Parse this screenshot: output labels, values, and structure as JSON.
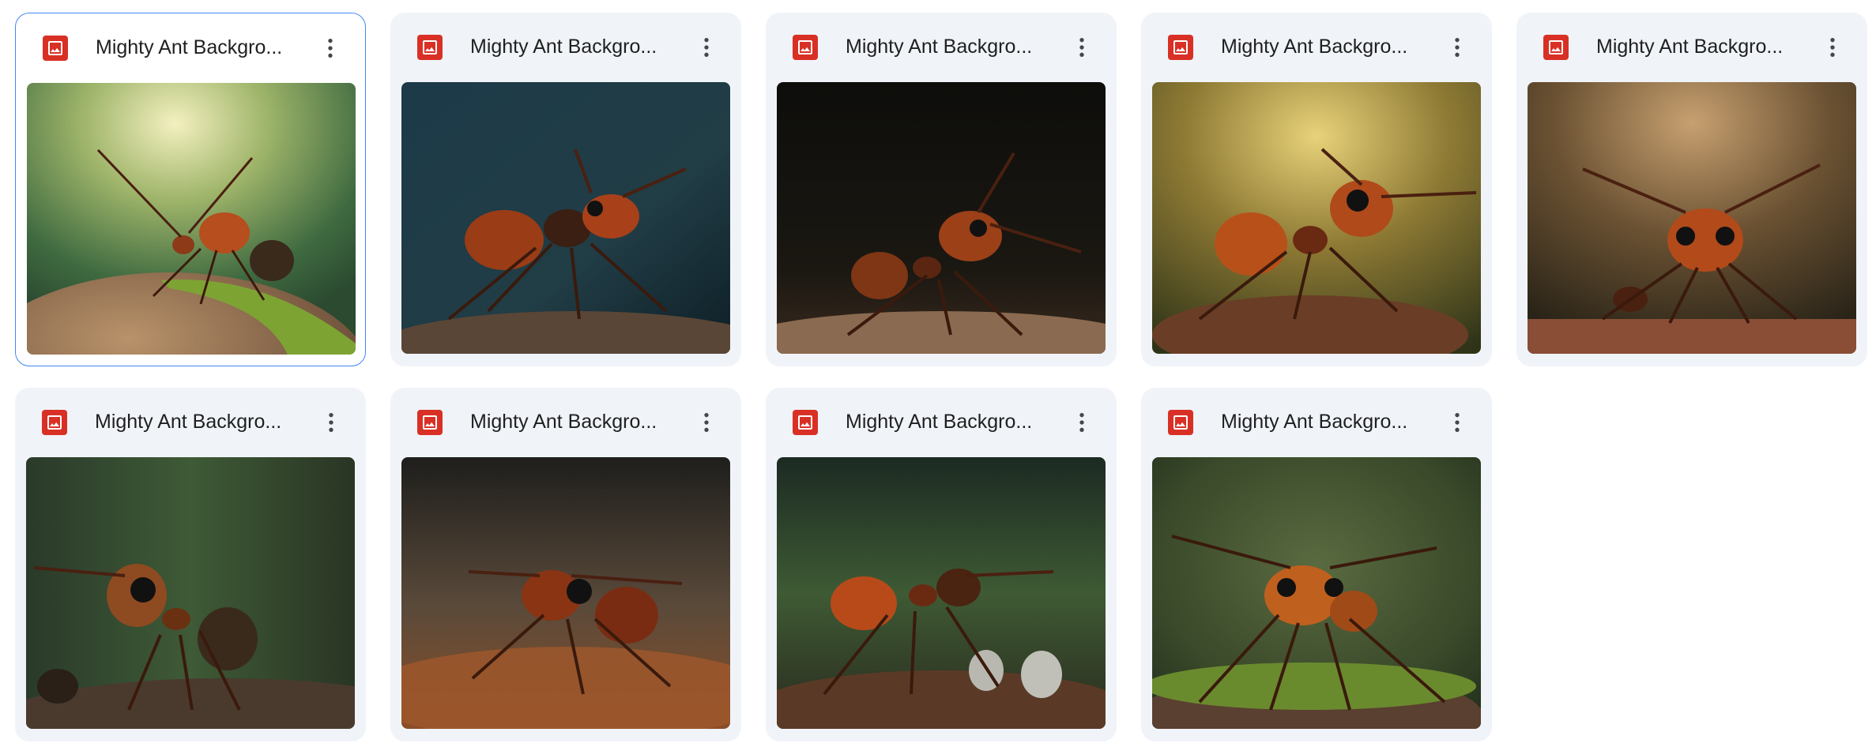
{
  "files": [
    {
      "name": "Mighty Ant Backgro...",
      "type_icon": "image-file-icon",
      "menu_icon": "more-vert-icon",
      "selected": true
    },
    {
      "name": "Mighty Ant Backgro...",
      "type_icon": "image-file-icon",
      "menu_icon": "more-vert-icon",
      "selected": false
    },
    {
      "name": "Mighty Ant Backgro...",
      "type_icon": "image-file-icon",
      "menu_icon": "more-vert-icon",
      "selected": false
    },
    {
      "name": "Mighty Ant Backgro...",
      "type_icon": "image-file-icon",
      "menu_icon": "more-vert-icon",
      "selected": false
    },
    {
      "name": "Mighty Ant Backgro...",
      "type_icon": "image-file-icon",
      "menu_icon": "more-vert-icon",
      "selected": false
    },
    {
      "name": "Mighty Ant Backgro...",
      "type_icon": "image-file-icon",
      "menu_icon": "more-vert-icon",
      "selected": false
    },
    {
      "name": "Mighty Ant Backgro...",
      "type_icon": "image-file-icon",
      "menu_icon": "more-vert-icon",
      "selected": false
    },
    {
      "name": "Mighty Ant Backgro...",
      "type_icon": "image-file-icon",
      "menu_icon": "more-vert-icon",
      "selected": false
    },
    {
      "name": "Mighty Ant Backgro...",
      "type_icon": "image-file-icon",
      "menu_icon": "more-vert-icon",
      "selected": false
    }
  ],
  "colors": {
    "card_bg": "#f0f4f9",
    "selected_border": "#4285f4",
    "file_icon_red": "#d93025",
    "title_text": "#1f1f1f"
  }
}
